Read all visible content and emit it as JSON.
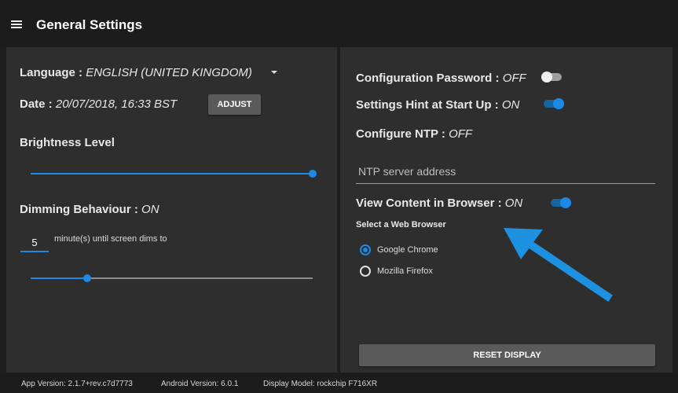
{
  "header": {
    "title": "General Settings",
    "menu_icon": "hamburger-menu-icon"
  },
  "left": {
    "language": {
      "label": "Language :",
      "value": "ENGLISH (UNITED KINGDOM)"
    },
    "date": {
      "label": "Date :",
      "value": "20/07/2018, 16:33 BST",
      "adjust_label": "ADJUST"
    },
    "brightness": {
      "label": "Brightness Level",
      "level": 1.0
    },
    "dimming": {
      "label": "Dimming Behaviour :",
      "value": "ON",
      "minutes": "5",
      "caption": "minute(s) until screen dims to",
      "dim_level": 0.2
    }
  },
  "right": {
    "config_password": {
      "label": "Configuration Password :",
      "value": "OFF",
      "on": false
    },
    "settings_hint": {
      "label": "Settings Hint at Start Up :",
      "value": "ON",
      "on": true
    },
    "ntp": {
      "label": "Configure NTP :",
      "value": "OFF",
      "placeholder": "NTP server address"
    },
    "view_browser": {
      "label": "View Content in Browser :",
      "value": "ON",
      "on": true
    },
    "browser": {
      "label": "Select a Web Browser",
      "options": [
        "Google Chrome",
        "Mozilla Firefox"
      ],
      "selected": "Google Chrome"
    },
    "reset_label": "RESET DISPLAY"
  },
  "annotation": {
    "arrow_color": "#1e90e0"
  },
  "colors": {
    "accent": "#1e88e5",
    "panel": "#2e2e2e",
    "background": "#1e1e1e"
  },
  "footer": {
    "app_version": "App Version: 2.1.7+rev.c7d7773",
    "android_version": "Android Version: 6.0.1",
    "display_model": "Display Model: rockchip F716XR"
  }
}
